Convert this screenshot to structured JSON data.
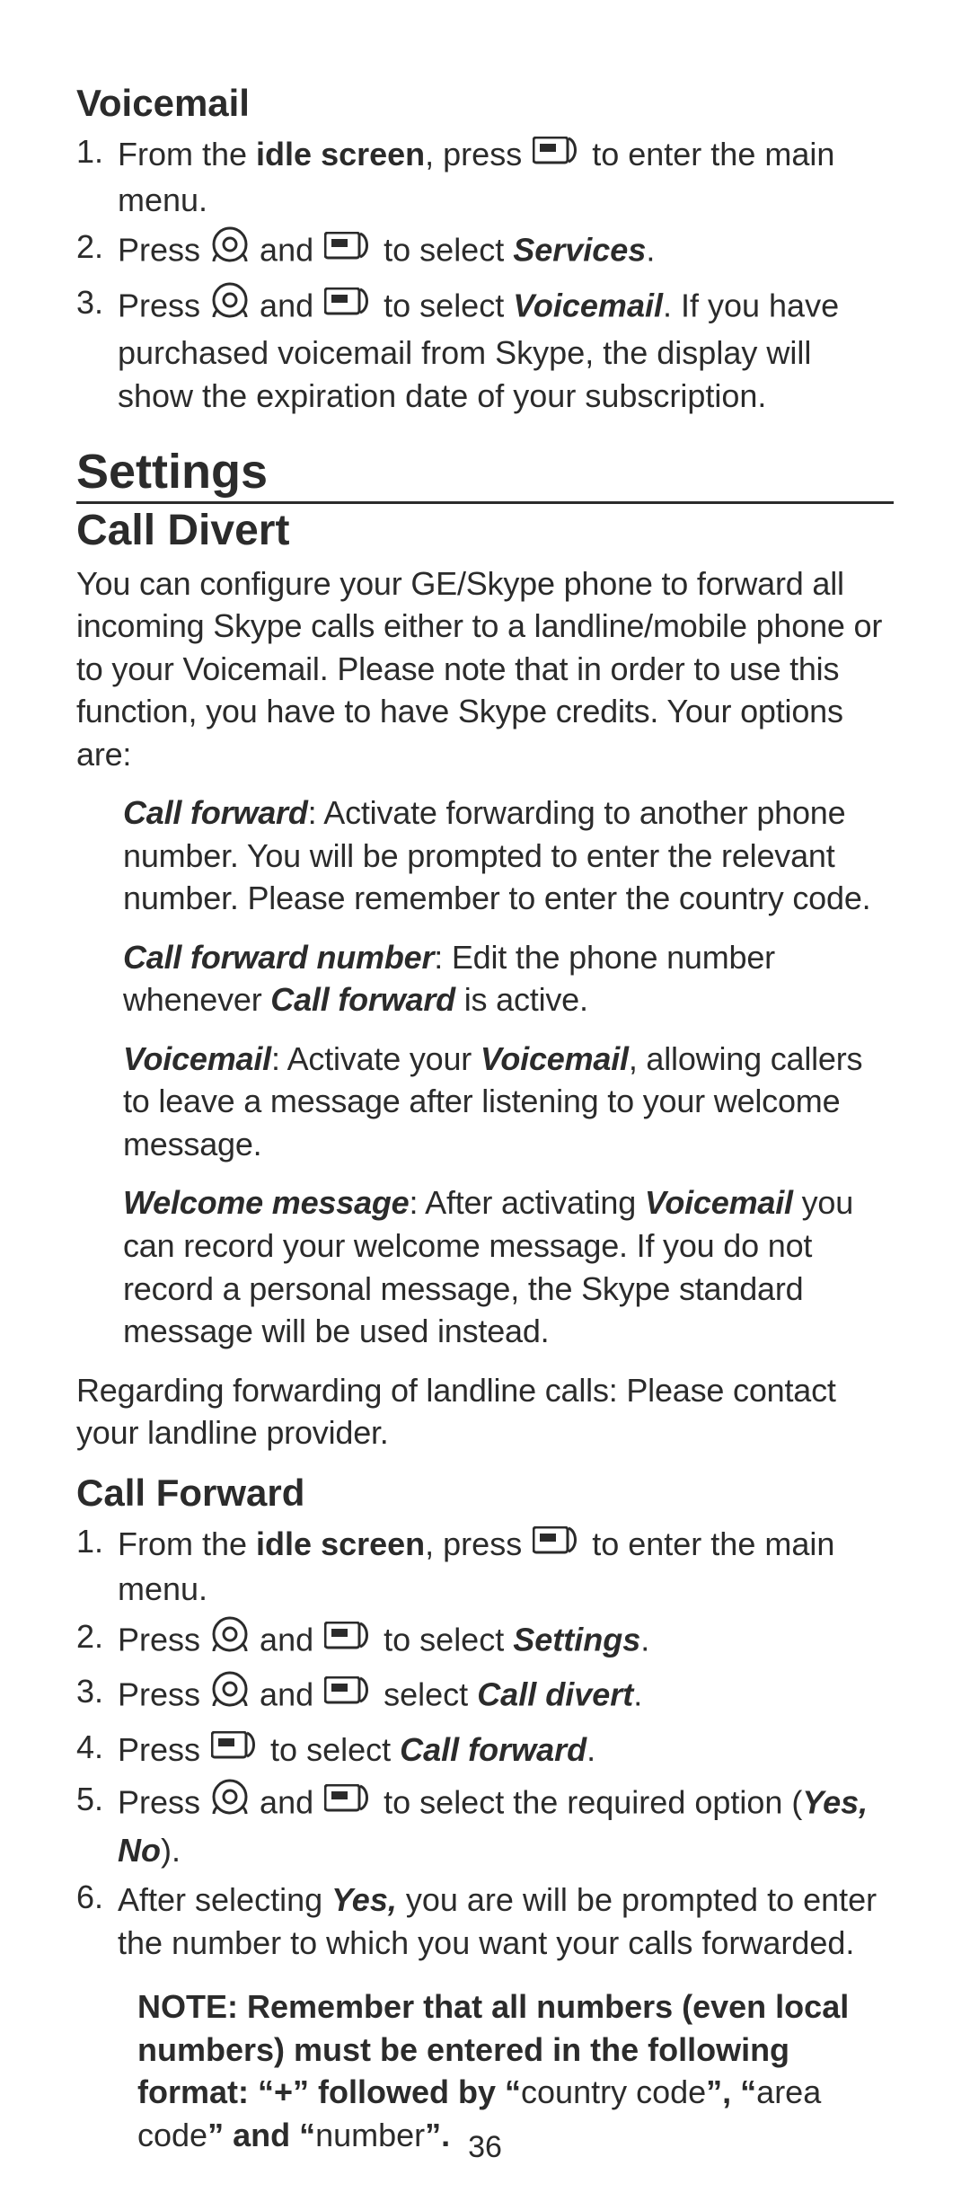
{
  "page_number": "36",
  "icons": {
    "softkey": "softkey-icon",
    "nav": "nav-dial-icon"
  },
  "sec_voicemail": {
    "title": "Voicemail",
    "steps": [
      {
        "n": "1.",
        "pre": "From the ",
        "bold": "idle screen",
        "mid": ", press ",
        "post": " to enter the main menu."
      },
      {
        "n": "2.",
        "pre": "Press ",
        "mid": " and ",
        "mid2": " to select ",
        "target": "Services",
        "post": "."
      },
      {
        "n": "3.",
        "pre": "Press ",
        "mid": " and ",
        "mid2": "  to select ",
        "target": "Voicemail",
        "post": ". If you have purchased voicemail from Skype, the display will show the expiration date of your subscription."
      }
    ]
  },
  "sec_settings": {
    "title": "Settings"
  },
  "sec_calldivert": {
    "title": "Call Divert",
    "intro": "You can configure your GE/Skype phone to forward all incoming Skype calls either to a landline/mobile phone or to your Voicemail. Please note that in order to use this function, you have to have Skype credits. Your options are:",
    "options": [
      {
        "name": "Call forward",
        "sep": ": ",
        "rest": "Activate forwarding to another phone number. You will be prompted to enter the relevant number. Please remember to enter the country code."
      },
      {
        "name": "Call forward number",
        "sep": ":   ",
        "rest_pre": "Edit the phone number whenever ",
        "rest_bi": "Call forward",
        "rest_post": " is active."
      },
      {
        "name": "Voicemail",
        "sep": ": ",
        "rest_pre": "Activate your ",
        "rest_bi": "Voicemail",
        "rest_post": ", allowing callers to leave a message after listening to your welcome message."
      },
      {
        "name": "Welcome message",
        "sep": ": ",
        "rest_pre": "After activating ",
        "rest_bi": "Voicemail",
        "rest_post": " you can record your welcome message. If you do not record a personal message, the Skype standard message will be used instead."
      }
    ],
    "landline_note": "Regarding forwarding of landline calls: Please contact your landline provider."
  },
  "sec_callforward": {
    "title": "Call Forward",
    "steps": [
      {
        "n": "1.",
        "pre": "From the ",
        "bold": "idle screen",
        "mid": ", press ",
        "post": " to enter the main menu."
      },
      {
        "n": "2.",
        "pre": "Press ",
        "mid": " and ",
        "mid2": " to select ",
        "target": "Settings",
        "post": "."
      },
      {
        "n": "3.",
        "pre": "Press ",
        "mid": " and ",
        "mid2": " select ",
        "target": "Call divert",
        "post": "."
      },
      {
        "n": "4.",
        "pre": "Press ",
        "mid2": " to select ",
        "target": "Call forward",
        "post": "."
      },
      {
        "n": "5.",
        "pre": "Press ",
        "mid": " and ",
        "mid2": " to select the required option (",
        "target": "Yes, No",
        "post": ")."
      },
      {
        "n": "6.",
        "pre": "After selecting ",
        "target0": "Yes,",
        "post": " you are will be prompted to enter the number to which you want your calls forwarded."
      }
    ],
    "note_bold1": "NOTE: Remember that all numbers (even local numbers) must be entered in the following format: “+” followed by “",
    "note_plain1": "country code",
    "note_bold2": "”, “",
    "note_plain2": "area code",
    "note_bold3": "” and “",
    "note_plain3": "number",
    "note_bold4": "”."
  }
}
